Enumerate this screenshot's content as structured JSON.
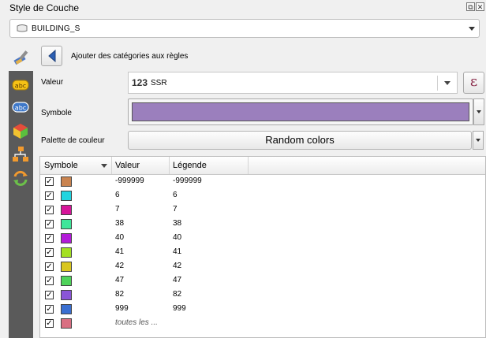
{
  "window": {
    "title": "Style de Couche"
  },
  "layer": {
    "name": "BUILDING_S"
  },
  "toolbar": {
    "apply_label": "Ajouter des catégories aux règles"
  },
  "form": {
    "valeur_label": "Valeur",
    "valeur_type": "123",
    "valeur_field": "SSR",
    "expression_glyph": "ε",
    "symbole_label": "Symbole",
    "symbol_color": "#9b7fbd",
    "palette_label": "Palette de couleur",
    "palette_value": "Random colors"
  },
  "table": {
    "headers": {
      "symbol": "Symbole",
      "value": "Valeur",
      "legend": "Légende"
    },
    "rows": [
      {
        "checked": "✓",
        "color": "#c9834f",
        "value": "-999999",
        "legend": "-999999"
      },
      {
        "checked": "✓",
        "color": "#22d4e0",
        "value": "6",
        "legend": "6"
      },
      {
        "checked": "✓",
        "color": "#d6159a",
        "value": "7",
        "legend": "7"
      },
      {
        "checked": "✓",
        "color": "#3ee69a",
        "value": "38",
        "legend": "38"
      },
      {
        "checked": "✓",
        "color": "#b31bd9",
        "value": "40",
        "legend": "40"
      },
      {
        "checked": "✓",
        "color": "#a3e023",
        "value": "41",
        "legend": "41"
      },
      {
        "checked": "✓",
        "color": "#d9c61f",
        "value": "42",
        "legend": "42"
      },
      {
        "checked": "✓",
        "color": "#4ed35a",
        "value": "47",
        "legend": "47"
      },
      {
        "checked": "✓",
        "color": "#8a55d8",
        "value": "82",
        "legend": "82"
      },
      {
        "checked": "✓",
        "color": "#3a6fd1",
        "value": "999",
        "legend": "999"
      },
      {
        "checked": "✓",
        "color": "#d96f82",
        "value": "toutes les ...",
        "legend": ""
      }
    ]
  },
  "sidebar": {
    "icons": [
      "label-abc-icon",
      "label-abc-outline-icon",
      "3d-cube-icon",
      "diagram-icon",
      "history-icon"
    ]
  }
}
